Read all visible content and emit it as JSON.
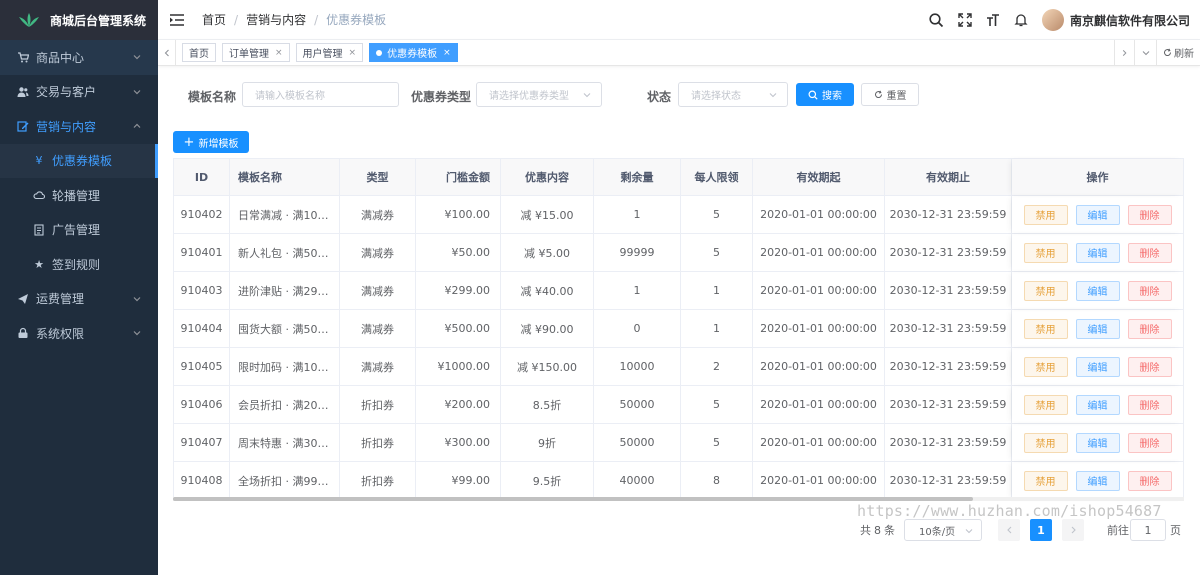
{
  "app": {
    "title": "商城后台管理系统"
  },
  "sidebar": {
    "items": [
      {
        "label": "商品中心",
        "icon": "cart-icon"
      },
      {
        "label": "交易与客户",
        "icon": "users-icon"
      },
      {
        "label": "营销与内容",
        "icon": "edit-icon"
      },
      {
        "label": "运费管理",
        "icon": "send-icon"
      },
      {
        "label": "系统权限",
        "icon": "lock-icon"
      }
    ],
    "sub_items": [
      {
        "label": "优惠券模板",
        "icon": "yen-icon"
      },
      {
        "label": "轮播管理",
        "icon": "cloud-icon"
      },
      {
        "label": "广告管理",
        "icon": "document-icon"
      },
      {
        "label": "签到规则",
        "icon": "star-icon"
      }
    ]
  },
  "header": {
    "breadcrumb": [
      "首页",
      "营销与内容",
      "优惠券模板"
    ],
    "company": "南京麒信软件有限公司"
  },
  "tags": {
    "items": [
      "首页",
      "订单管理",
      "用户管理",
      "优惠券模板"
    ],
    "refresh": "刷新"
  },
  "search": {
    "name_label": "模板名称",
    "name_placeholder": "请输入模板名称",
    "type_label": "优惠券类型",
    "type_placeholder": "请选择优惠券类型",
    "status_label": "状态",
    "status_placeholder": "请选择状态",
    "search_btn": "搜索",
    "reset_btn": "重置"
  },
  "actions": {
    "add_btn": "新增模板"
  },
  "table": {
    "columns": [
      "ID",
      "模板名称",
      "类型",
      "门槛金额",
      "优惠内容",
      "剩余量",
      "每人限领",
      "有效期起",
      "有效期止",
      "操作"
    ],
    "rows": [
      [
        "910402",
        "日常满减 · 满10…",
        "满减券",
        "¥100.00",
        "减 ¥15.00",
        "1",
        "5",
        "2020-01-01 00:00:00",
        "2030-12-31 23:59:59"
      ],
      [
        "910401",
        "新人礼包 · 满50…",
        "满减券",
        "¥50.00",
        "减 ¥5.00",
        "99999",
        "5",
        "2020-01-01 00:00:00",
        "2030-12-31 23:59:59"
      ],
      [
        "910403",
        "进阶津贴 · 满29…",
        "满减券",
        "¥299.00",
        "减 ¥40.00",
        "1",
        "1",
        "2020-01-01 00:00:00",
        "2030-12-31 23:59:59"
      ],
      [
        "910404",
        "囤货大额 · 满50…",
        "满减券",
        "¥500.00",
        "减 ¥90.00",
        "0",
        "1",
        "2020-01-01 00:00:00",
        "2030-12-31 23:59:59"
      ],
      [
        "910405",
        "限时加码 · 满10…",
        "满减券",
        "¥1000.00",
        "减 ¥150.00",
        "10000",
        "2",
        "2020-01-01 00:00:00",
        "2030-12-31 23:59:59"
      ],
      [
        "910406",
        "会员折扣 · 满20…",
        "折扣券",
        "¥200.00",
        "8.5折",
        "50000",
        "5",
        "2020-01-01 00:00:00",
        "2030-12-31 23:59:59"
      ],
      [
        "910407",
        "周末特惠 · 满30…",
        "折扣券",
        "¥300.00",
        "9折",
        "50000",
        "5",
        "2020-01-01 00:00:00",
        "2030-12-31 23:59:59"
      ],
      [
        "910408",
        "全场折扣 · 满99…",
        "折扣券",
        "¥99.00",
        "9.5折",
        "40000",
        "8",
        "2020-01-01 00:00:00",
        "2030-12-31 23:59:59"
      ]
    ],
    "op_disable": "禁用",
    "op_edit": "编辑",
    "op_delete": "删除"
  },
  "pagination": {
    "total_prefix": "共",
    "total": "8",
    "total_suffix": "条",
    "page_size": "10条/页",
    "current_page": "1",
    "goto_prefix": "前往",
    "goto_value": "1",
    "goto_suffix": "页"
  },
  "watermark": "https://www.huzhan.com/ishop54687",
  "colors": {
    "sidebar_bg": "#1f2d3d",
    "primary": "#1890ff",
    "active_menu": "#409eff"
  }
}
